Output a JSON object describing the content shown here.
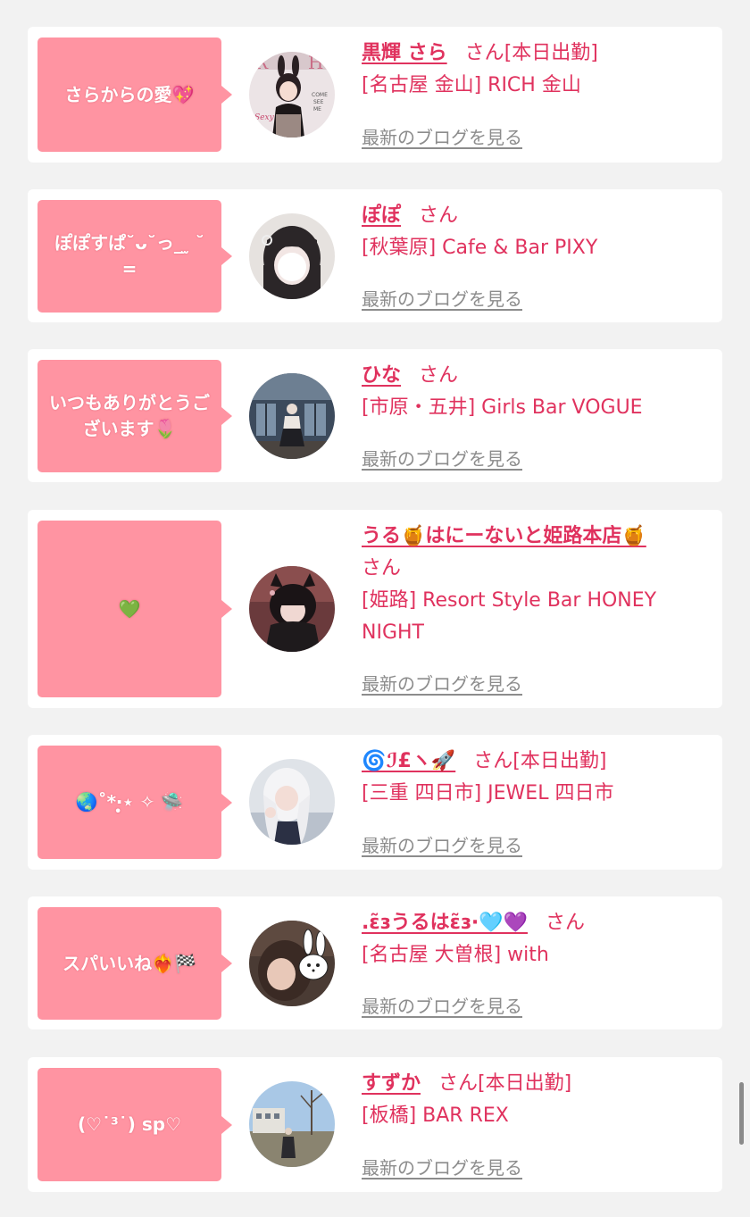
{
  "entries": [
    {
      "message": "さらからの愛💖",
      "name": "黒輝 さら",
      "honorific": "さん",
      "status": "[本日出勤]",
      "shop": "[名古屋 金山] RICH 金山",
      "blog_link": "最新のブログを見る"
    },
    {
      "message": "ぽぽすぱ˘ᴗ˘っ_ ̫ ˘ =",
      "name": "ぽぽ",
      "honorific": "さん",
      "status": "",
      "shop": "[秋葉原] Cafe & Bar PIXY",
      "blog_link": "最新のブログを見る"
    },
    {
      "message": "いつもありがとうございます🌷",
      "name": "ひな",
      "honorific": "さん",
      "status": "",
      "shop": "[市原・五井] Girls Bar VOGUE",
      "blog_link": "最新のブログを見る"
    },
    {
      "message": "💚",
      "name": "うる🍯はにーないと姫路本店🍯",
      "honorific": "さん",
      "status": "",
      "shop": "[姫路] Resort Style Bar HONEY NIGHT",
      "blog_link": "最新のブログを見る"
    },
    {
      "message": "🌏˚*‧̩̥⋆ ✧ 🛸",
      "name": "🌀ℐ£ヽ🚀",
      "honorific": "さん",
      "status": "[本日出勤]",
      "shop": "[三重 四日市] JEWEL 四日市",
      "blog_link": "最新のブログを見る"
    },
    {
      "message": "スパいいね❤️‍🔥🏁",
      "name": ".ɛ̃ɜうるはɛ̃ɜ·🩵💜",
      "honorific": "さん",
      "status": "",
      "shop": "[名古屋 大曽根] with",
      "blog_link": "最新のブログを見る"
    },
    {
      "message": "(♡˙³˙) sp♡",
      "name": "すずか",
      "honorific": "さん",
      "status": "[本日出勤]",
      "shop": "[板橋] BAR REX",
      "blog_link": "最新のブログを見る"
    }
  ],
  "colors": {
    "background": "#f2f2f2",
    "card": "#ffffff",
    "bubble": "#ff94a2",
    "accent_text": "#e0325e",
    "link_gray": "#8c8c8c"
  }
}
